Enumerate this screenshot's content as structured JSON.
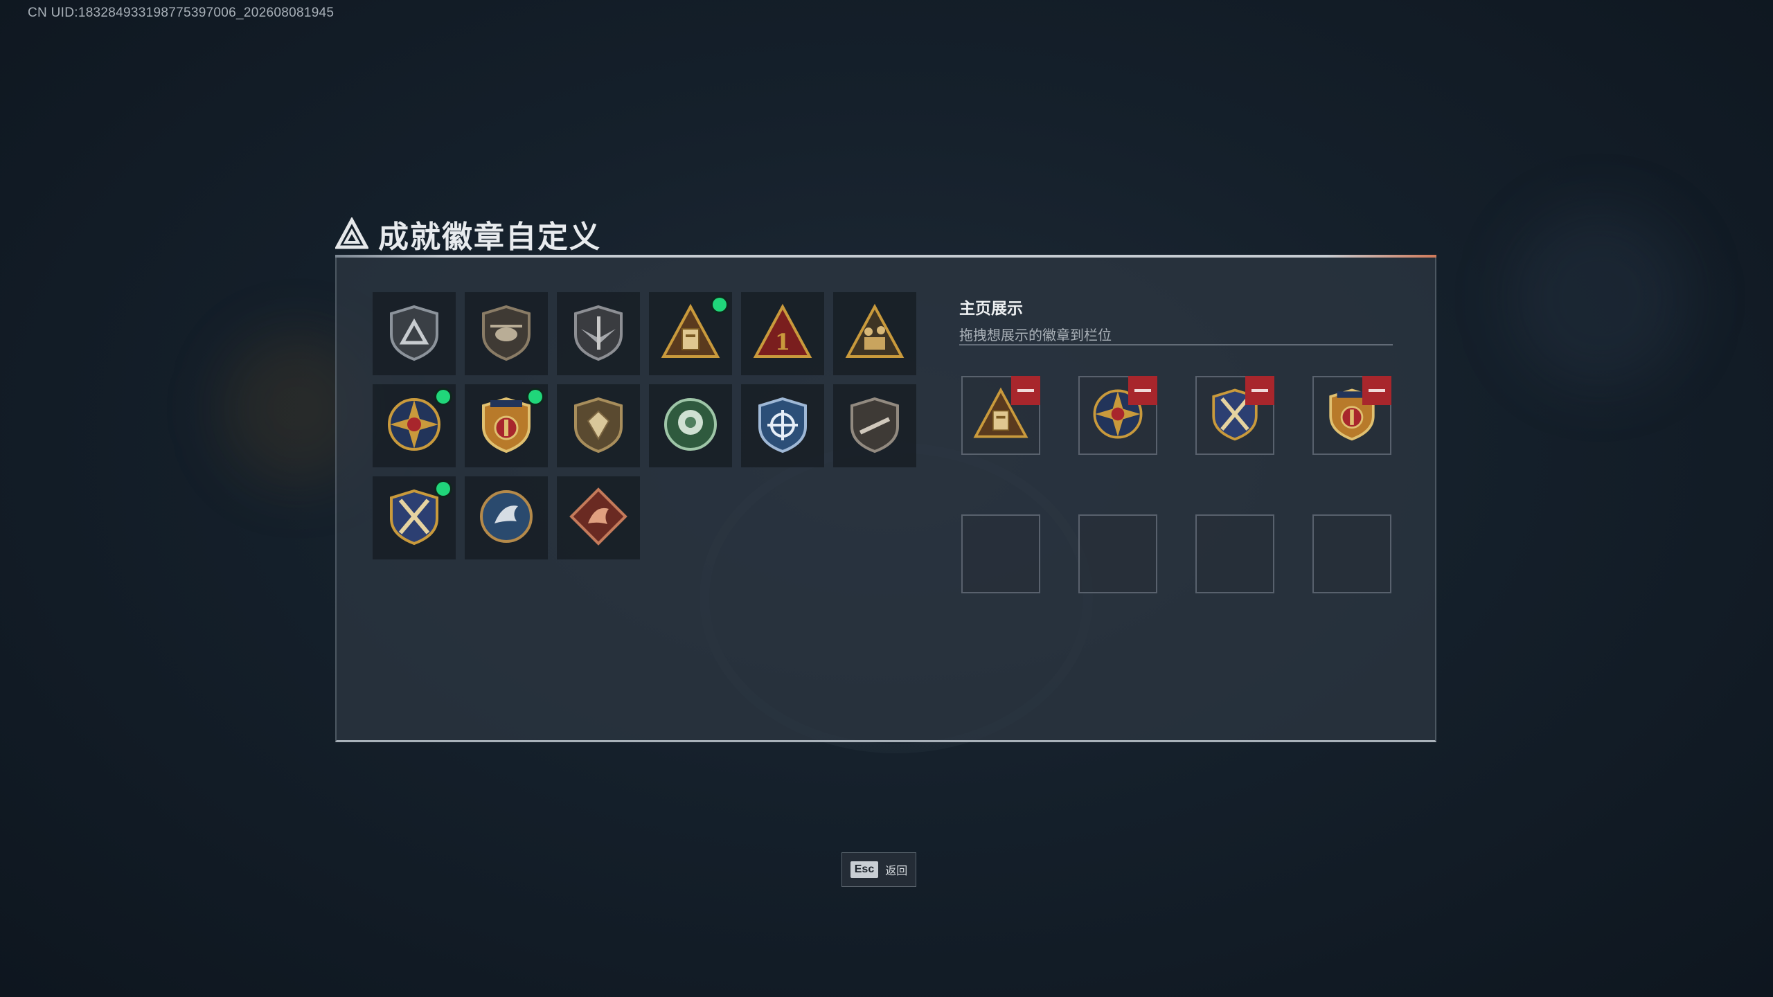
{
  "uid_text": "CN UID:1832849331987753970​06_202608081945",
  "page": {
    "title": "成就徽章自定义"
  },
  "badge_grid": {
    "badges": [
      {
        "icon": "triangle-logo-shield-badge",
        "new": false
      },
      {
        "icon": "helicopter-shield-badge",
        "new": false
      },
      {
        "icon": "sword-wings-shield-badge",
        "new": false
      },
      {
        "icon": "gold-triangle-crate-badge",
        "new": true
      },
      {
        "icon": "red-triangle-number-one-badge",
        "new": false
      },
      {
        "icon": "soldiers-triangle-badge",
        "new": false
      },
      {
        "icon": "star-compass-medal-badge",
        "new": true
      },
      {
        "icon": "eagle-crest-shield-badge",
        "new": true
      },
      {
        "icon": "gem-shield-badge",
        "new": false
      },
      {
        "icon": "green-rose-emblem-badge",
        "new": false
      },
      {
        "icon": "blue-crosshair-shield-badge",
        "new": false
      },
      {
        "icon": "rifle-shield-badge",
        "new": false
      },
      {
        "icon": "crossed-swords-gold-shield-badge",
        "new": true
      },
      {
        "icon": "silver-dragon-round-badge",
        "new": false
      },
      {
        "icon": "red-dragon-diamond-badge",
        "new": false
      }
    ]
  },
  "showcase": {
    "title": "主页展示",
    "subtitle": "拖拽想展示的徽章到栏位",
    "slots": [
      {
        "icon": "gold-triangle-crate-badge",
        "filled": true
      },
      {
        "icon": "star-compass-medal-badge",
        "filled": true
      },
      {
        "icon": "crossed-swords-gold-shield-badge",
        "filled": true
      },
      {
        "icon": "eagle-crest-shield-badge",
        "filled": true
      },
      {
        "icon": "",
        "filled": false
      },
      {
        "icon": "",
        "filled": false
      },
      {
        "icon": "",
        "filled": false
      },
      {
        "icon": "",
        "filled": false
      }
    ]
  },
  "footer": {
    "esc_key": "Esc",
    "esc_label": "返回"
  },
  "colors": {
    "accent_new": "#20d67a",
    "remove": "#a8262c",
    "gold": "#c99a3c"
  }
}
